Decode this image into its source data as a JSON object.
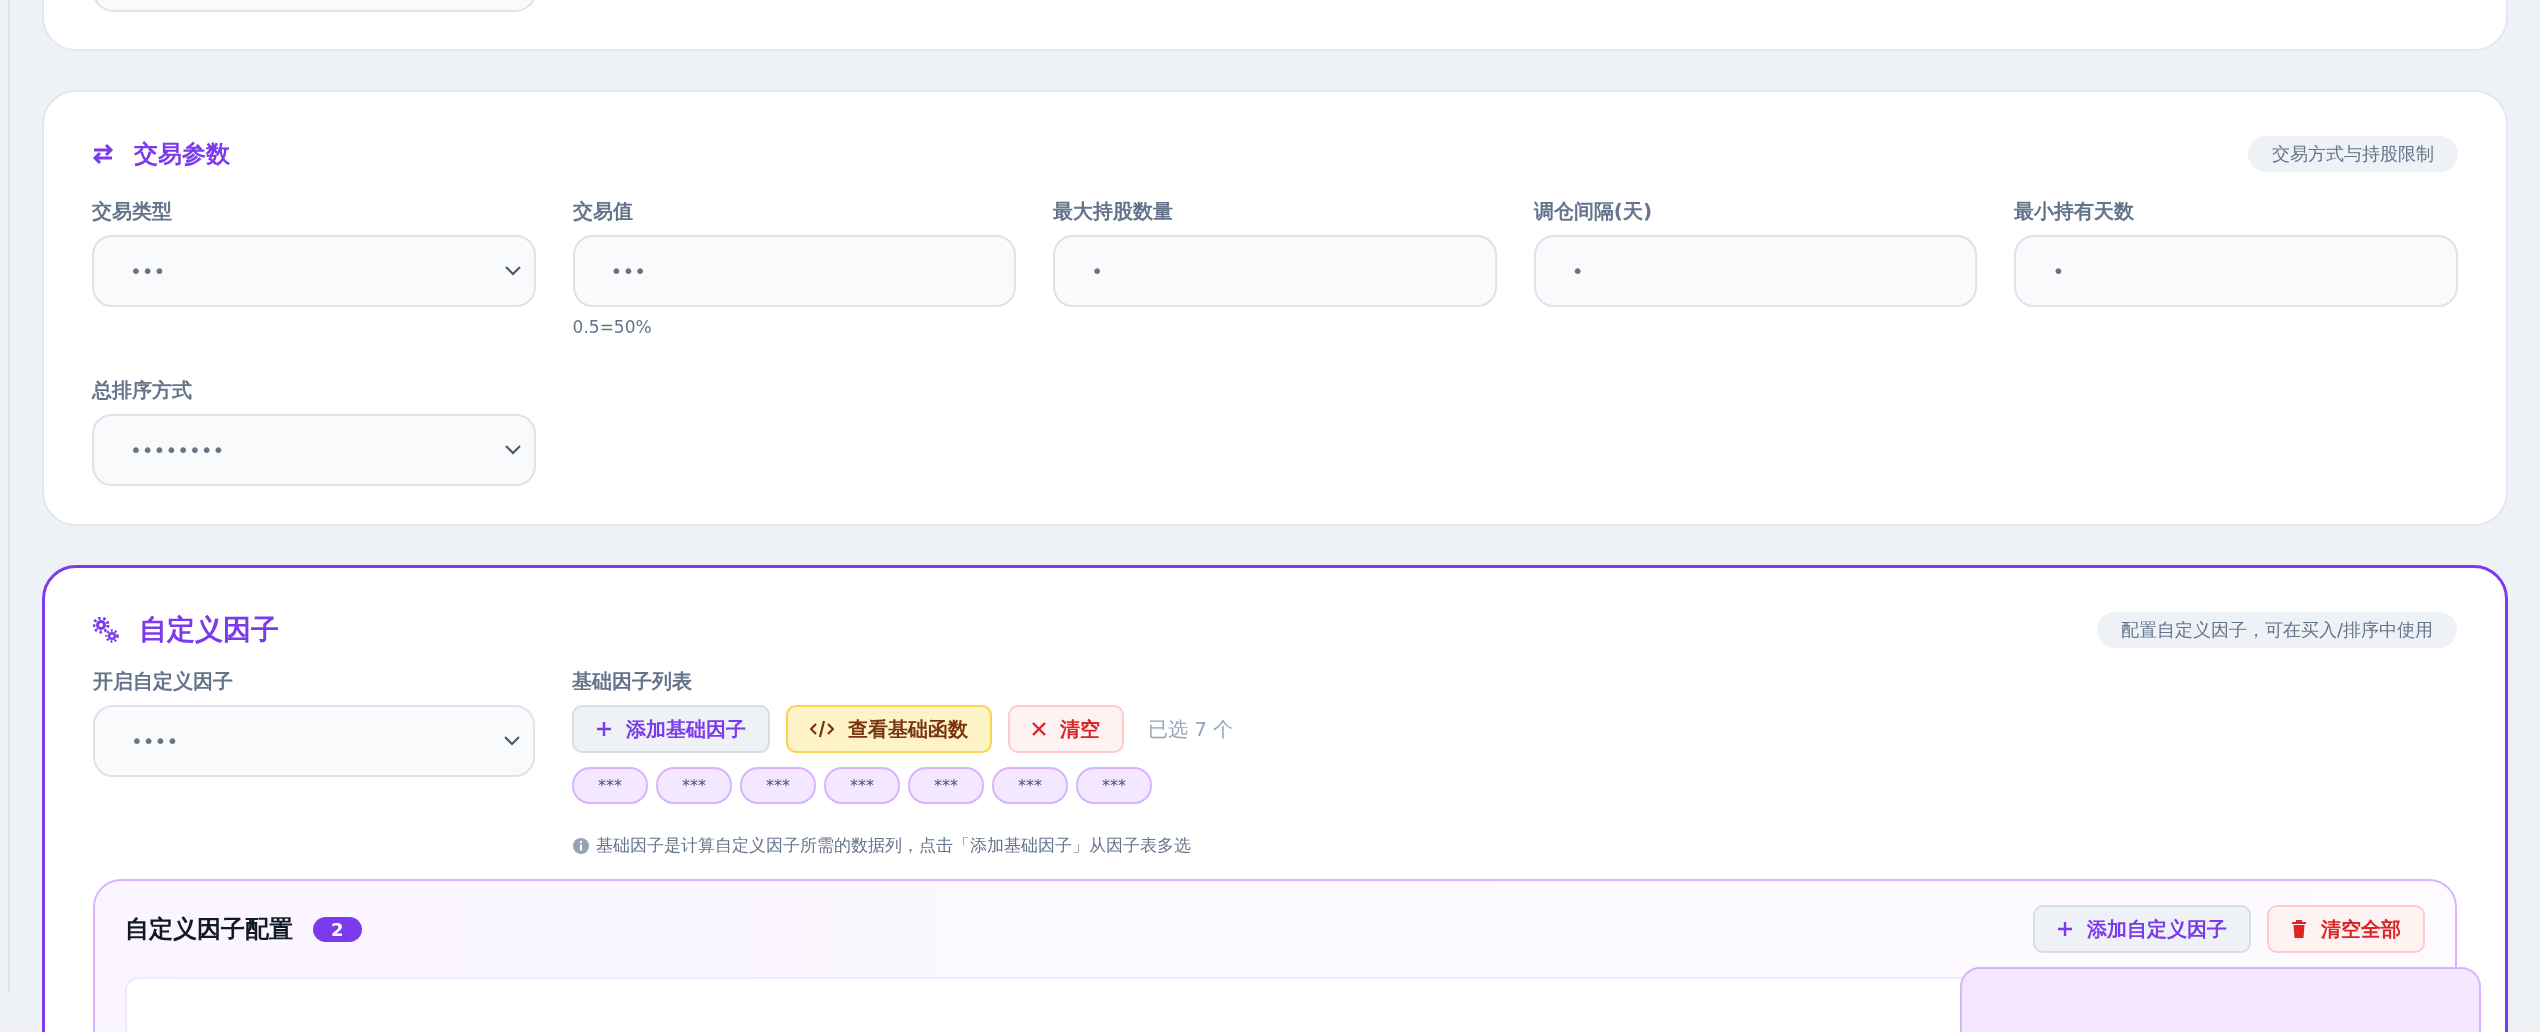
{
  "trade_params": {
    "title": "交易参数",
    "tag": "交易方式与持股限制",
    "fields": [
      {
        "label": "交易类型",
        "kind": "select",
        "value": "•••"
      },
      {
        "label": "交易值",
        "kind": "input",
        "value": "•••",
        "hint": "0.5=50%"
      },
      {
        "label": "最大持股数量",
        "kind": "input",
        "value": "•"
      },
      {
        "label": "调仓间隔(天)",
        "kind": "input",
        "value": "•"
      },
      {
        "label": "最小持有天数",
        "kind": "input",
        "value": "•"
      },
      {
        "label": "总排序方式",
        "kind": "select",
        "value": "••••••••"
      }
    ]
  },
  "custom_factor": {
    "title": "自定义因子",
    "tag": "配置自定义因子，可在买入/排序中使用",
    "enable": {
      "label": "开启自定义因子",
      "kind": "select",
      "value": "••••"
    },
    "base": {
      "label": "基础因子列表",
      "buttons": [
        {
          "label": "添加基础因子",
          "kind": "add"
        },
        {
          "label": "查看基础函数",
          "kind": "view"
        },
        {
          "label": "清空",
          "kind": "clear"
        }
      ],
      "count": "已选 7 个",
      "chips": [
        "***",
        "***",
        "***",
        "***",
        "***",
        "***",
        "***"
      ],
      "info": "基础因子是计算自定义因子所需的数据列，点击「添加基础因子」从因子表多选"
    },
    "config": {
      "title": "自定义因子配置",
      "count": "2",
      "buttons": [
        {
          "label": "添加自定义因子",
          "kind": "add"
        },
        {
          "label": "清空全部",
          "kind": "clear_all"
        }
      ]
    }
  }
}
